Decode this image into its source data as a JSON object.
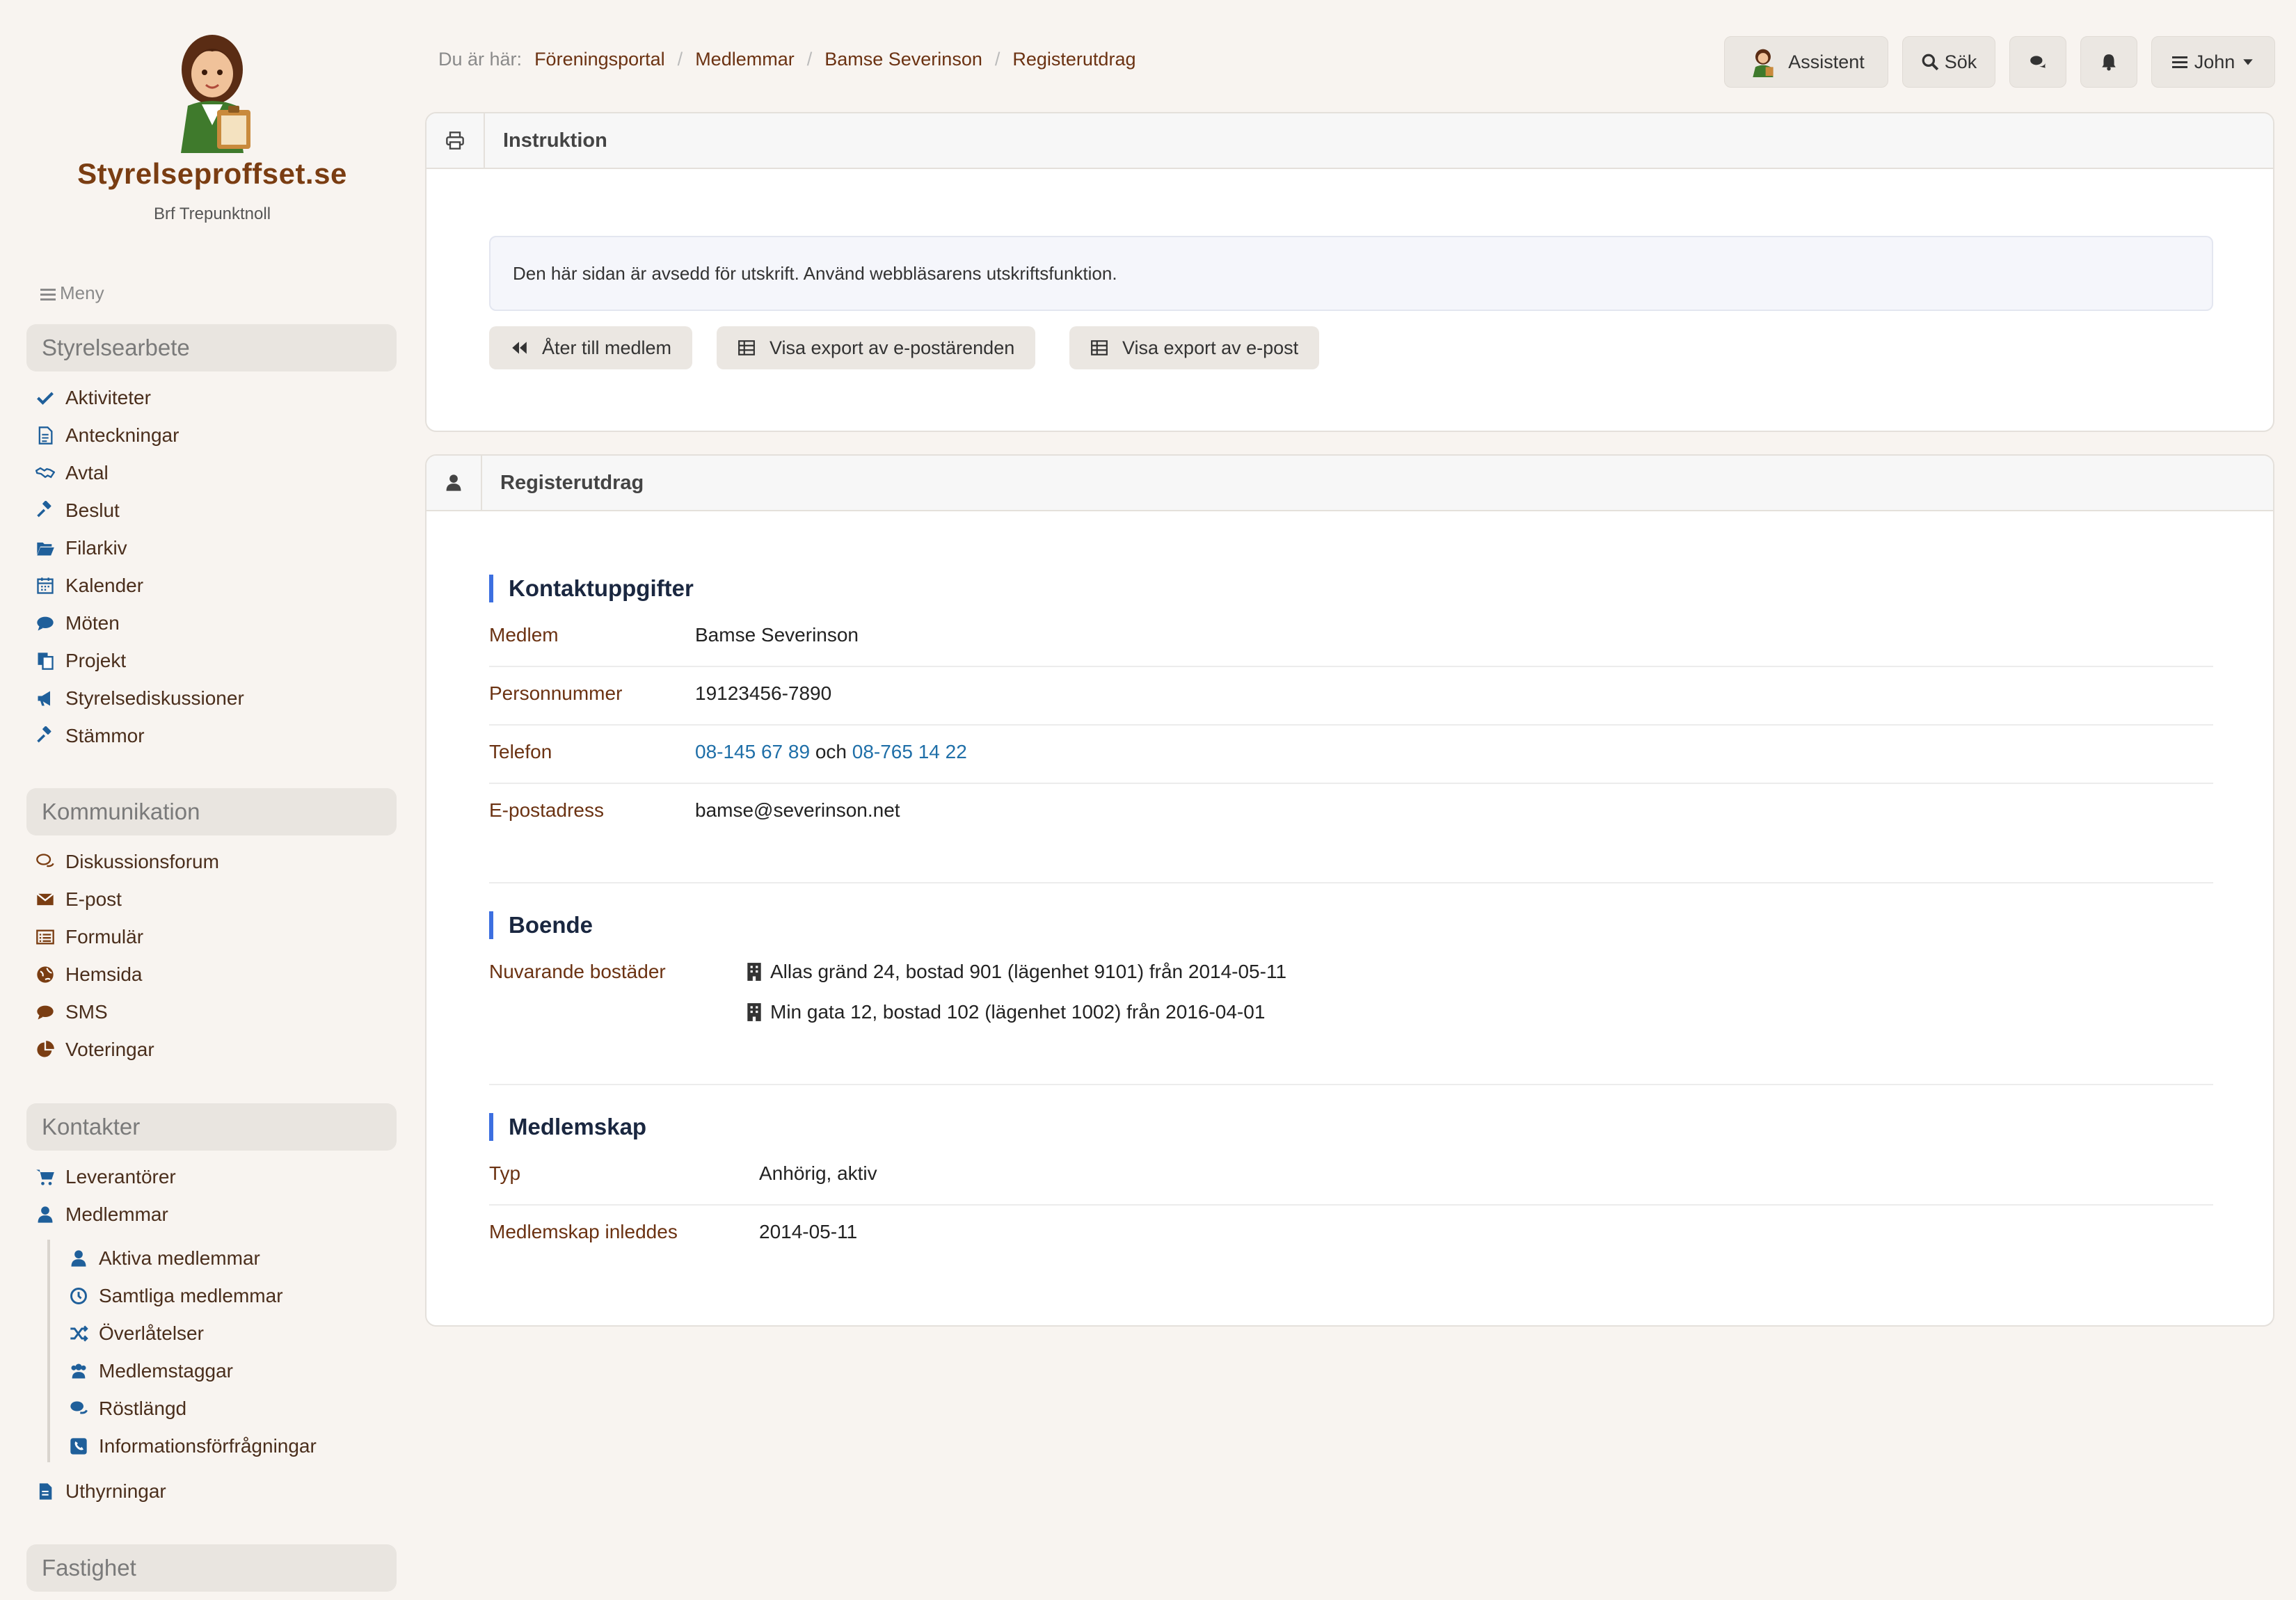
{
  "brand": {
    "name": "Styrelseproffset.se",
    "org": "Brf Trepunktnoll"
  },
  "menu_label": "Meny",
  "sidebar": {
    "sections": [
      {
        "title": "Styrelsearbete"
      },
      {
        "title": "Kommunikation"
      },
      {
        "title": "Kontakter"
      },
      {
        "title": "Fastighet"
      }
    ],
    "styrelsearbete": [
      "Aktiviteter",
      "Anteckningar",
      "Avtal",
      "Beslut",
      "Filarkiv",
      "Kalender",
      "Möten",
      "Projekt",
      "Styrelsediskussioner",
      "Stämmor"
    ],
    "kommunikation": [
      "Diskussionsforum",
      "E-post",
      "Formulär",
      "Hemsida",
      "SMS",
      "Voteringar"
    ],
    "kontakter": [
      "Leverantörer",
      "Medlemmar"
    ],
    "medlemmar_sub": [
      "Aktiva medlemmar",
      "Samtliga medlemmar",
      "Överlåtelser",
      "Medlemstaggar",
      "Röstlängd",
      "Informationsförfrågningar"
    ],
    "kontakter_after": [
      "Uthyrningar"
    ]
  },
  "breadcrumb": {
    "lead": "Du är här:",
    "items": [
      "Föreningsportal",
      "Medlemmar",
      "Bamse Severinson",
      "Registerutdrag"
    ]
  },
  "topbar": {
    "assistant": "Assistent",
    "search": "Sök",
    "user": "John"
  },
  "instruction_panel": {
    "title": "Instruktion",
    "alert": "Den här sidan är avsedd för utskrift. Använd webbläsarens utskriftsfunktion.",
    "buttons": [
      "Åter till medlem",
      "Visa export av e-postärenden",
      "Visa export av e-post"
    ]
  },
  "register_panel": {
    "title": "Registerutdrag",
    "contact": {
      "title": "Kontaktuppgifter",
      "member_label": "Medlem",
      "member": "Bamse Severinson",
      "pnr_label": "Personnummer",
      "pnr": "19123456-7890",
      "phone_label": "Telefon",
      "phone1": "08-145 67 89",
      "phone_and": "och",
      "phone2": "08-765 14 22",
      "email_label": "E-postadress",
      "email": "bamse@severinson.net"
    },
    "housing": {
      "title": "Boende",
      "label": "Nuvarande bostäder",
      "items": [
        "Allas gränd 24, bostad 901 (lägenhet 9101) från 2014-05-11",
        "Min gata 12, bostad 102 (lägenhet 1002) från 2016-04-01"
      ]
    },
    "membership": {
      "title": "Medlemskap",
      "type_label": "Typ",
      "type": "Anhörig, aktiv",
      "start_label": "Medlemskap inleddes",
      "start": "2014-05-11"
    }
  }
}
